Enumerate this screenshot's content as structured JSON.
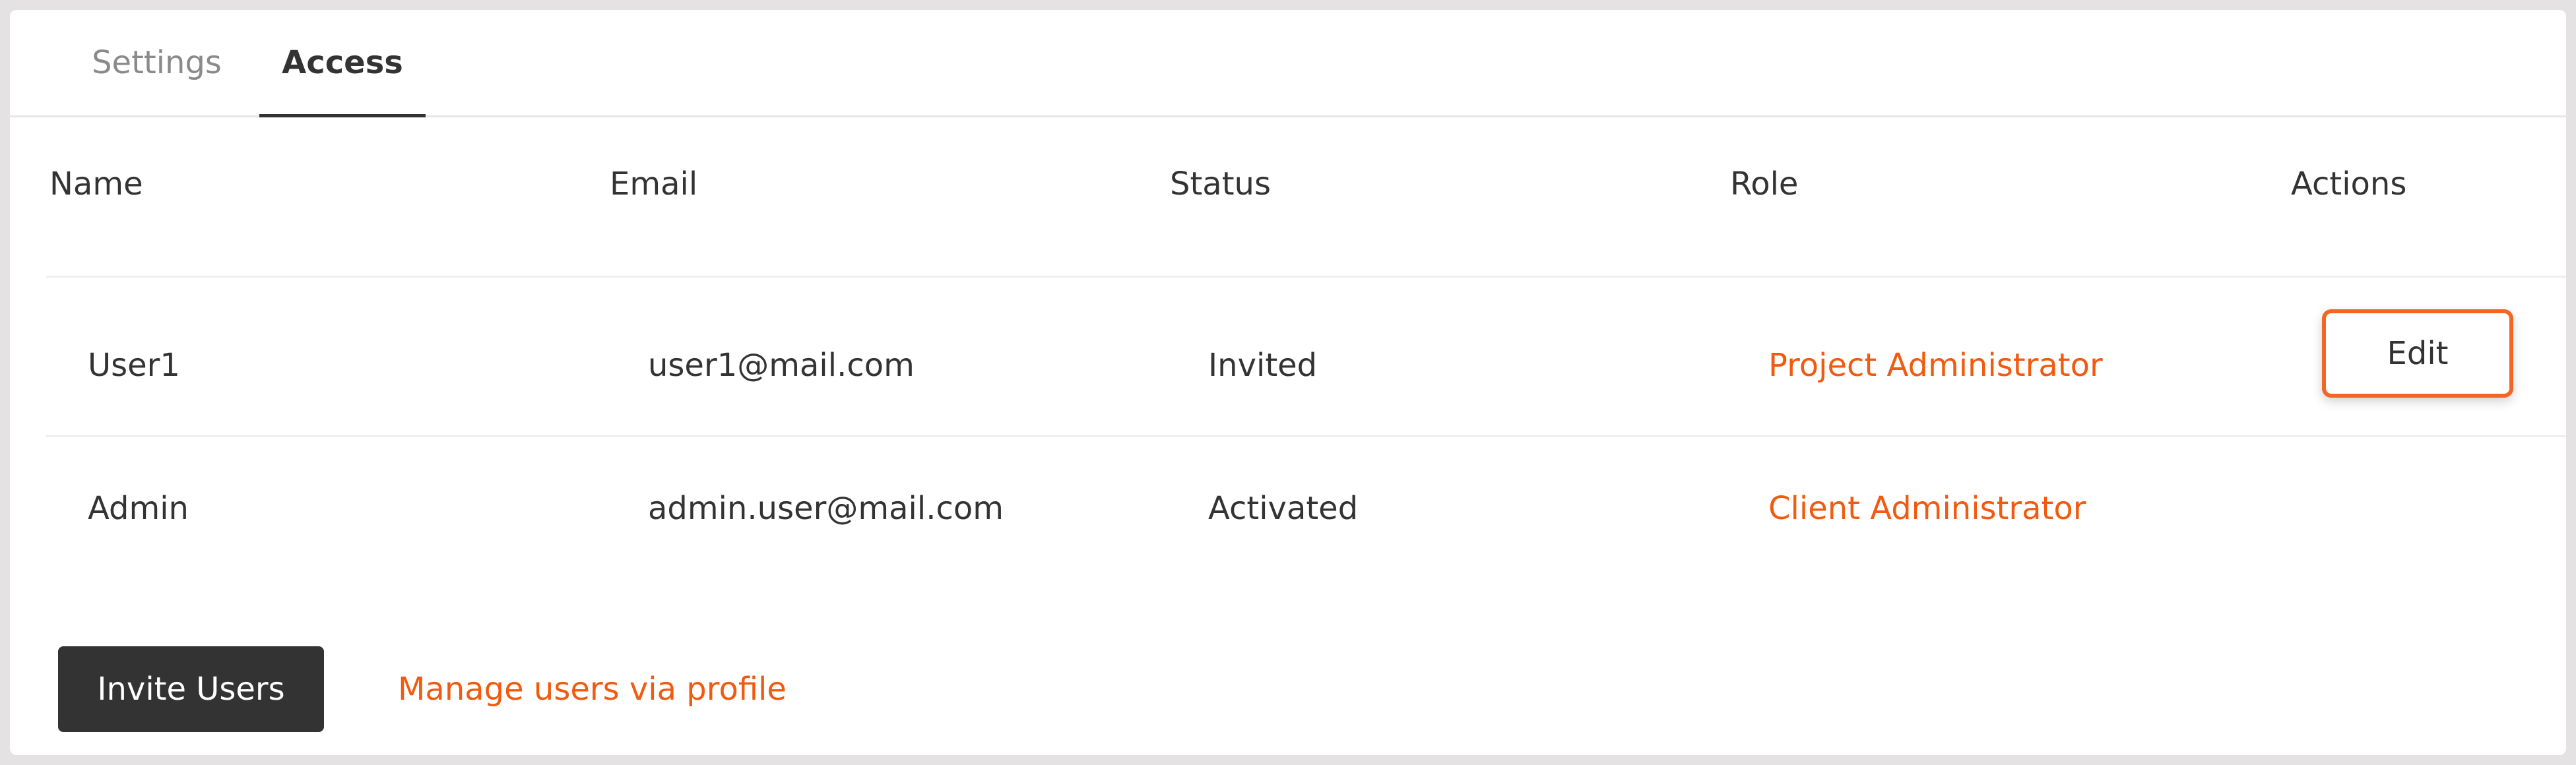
{
  "tabs": [
    {
      "label": "Settings",
      "active": false
    },
    {
      "label": "Access",
      "active": true
    }
  ],
  "table": {
    "columns": [
      "Name",
      "Email",
      "Status",
      "Role",
      "Actions"
    ],
    "rows": [
      {
        "name": "User1",
        "email": "user1@mail.com",
        "status": "Invited",
        "role": "Project Administrator",
        "action": "Edit"
      },
      {
        "name": "Admin",
        "email": "admin.user@mail.com",
        "status": "Activated",
        "role": "Client Administrator",
        "action": ""
      }
    ]
  },
  "footer": {
    "invite_label": "Invite Users",
    "manage_link": "Manage users via profile"
  },
  "colors": {
    "accent": "#f15a0f",
    "primary_button": "#333333",
    "text": "#333333",
    "muted_text": "#8a8a8a",
    "background": "#e4e2e2"
  }
}
